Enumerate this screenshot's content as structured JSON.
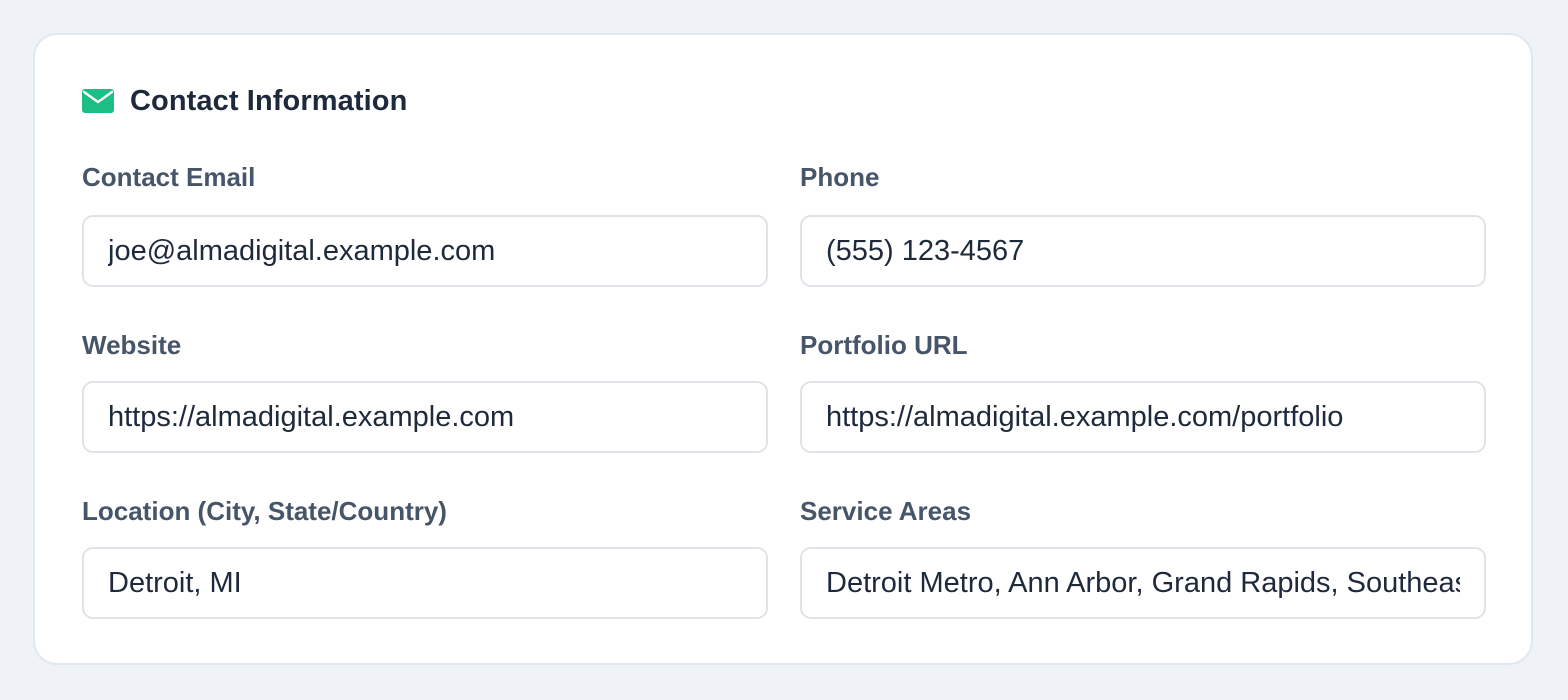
{
  "section": {
    "title": "Contact Information",
    "icon": "mail-icon",
    "accent_color": "#1bbf83"
  },
  "fields": {
    "contact_email": {
      "label": "Contact Email",
      "value": "joe@almadigital.example.com"
    },
    "phone": {
      "label": "Phone",
      "value": "(555) 123-4567"
    },
    "website": {
      "label": "Website",
      "value": "https://almadigital.example.com"
    },
    "portfolio_url": {
      "label": "Portfolio URL",
      "value": "https://almadigital.example.com/portfolio"
    },
    "location": {
      "label": "Location (City, State/Country)",
      "value": "Detroit, MI"
    },
    "service_areas": {
      "label": "Service Areas",
      "value": "Detroit Metro, Ann Arbor, Grand Rapids, Southeast Michigan"
    }
  }
}
